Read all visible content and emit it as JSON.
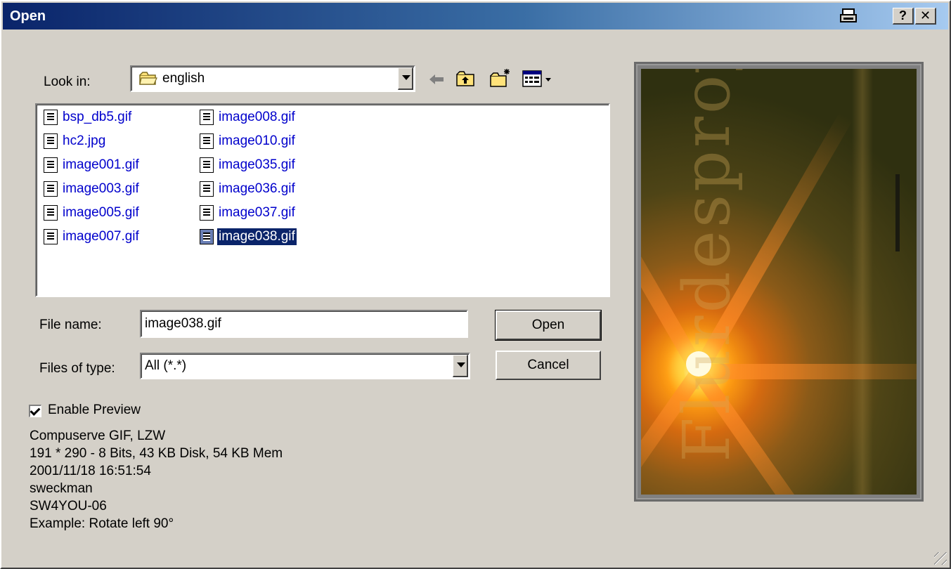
{
  "window": {
    "title": "Open"
  },
  "titlebar": {
    "help_label": "?",
    "close_label": "✕"
  },
  "look_in": {
    "label": "Look in:",
    "value": "english"
  },
  "files": {
    "column1": [
      "bsp_db5.gif",
      "hc2.jpg",
      "image001.gif",
      "image003.gif",
      "image005.gif",
      "image007.gif"
    ],
    "column2": [
      "image008.gif",
      "image010.gif",
      "image035.gif",
      "image036.gif",
      "image037.gif",
      "image038.gif"
    ],
    "selected": "image038.gif"
  },
  "file_name": {
    "label": "File name:",
    "value": "image038.gif"
  },
  "files_of_type": {
    "label": "Files of type:",
    "value": "All (*.*)"
  },
  "buttons": {
    "open": "Open",
    "cancel": "Cancel"
  },
  "preview": {
    "enable_label": "Enable Preview",
    "enabled": true,
    "watermark_text": "Flurdesproy"
  },
  "info": {
    "line1": "Compuserve GIF, LZW",
    "line2": "191 * 290  -  8 Bits, 43 KB Disk, 54 KB Mem",
    "line3": "2001/11/18 16:51:54",
    "line4": "sweckman",
    "line5": "SW4YOU-06",
    "line6": "Example: Rotate left 90°"
  },
  "icons": [
    "folder-icon",
    "back-icon",
    "up-folder-icon",
    "new-folder-icon",
    "view-menu-icon",
    "print-icon"
  ]
}
